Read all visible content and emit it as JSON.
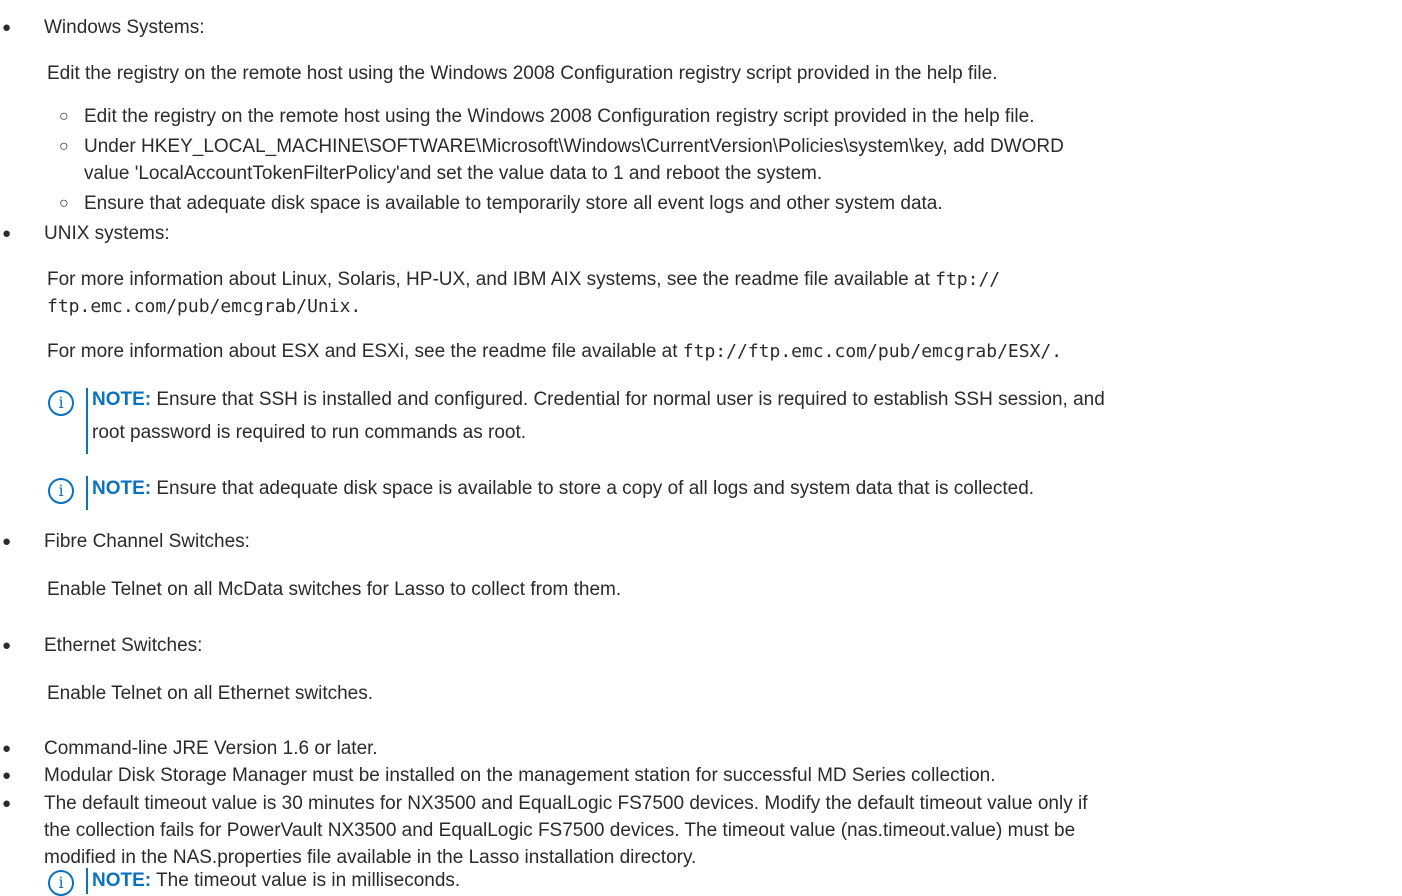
{
  "items": {
    "windows": {
      "heading": "Windows Systems:",
      "para": "Edit the registry on the remote host using the Windows 2008 Configuration registry script provided in the help file.",
      "sub": [
        "Edit the registry on the remote host using the Windows 2008 Configuration registry script provided in the help file.",
        "Under HKEY_LOCAL_MACHINE\\SOFTWARE\\Microsoft\\Windows\\CurrentVersion\\Policies\\system\\key, add DWORD",
        "value 'LocalAccountTokenFilterPolicy'and set the value data to 1 and reboot the system.",
        "Ensure that adequate disk space is available to temporarily store all event logs and other system data."
      ]
    },
    "unix": {
      "heading": "UNIX systems:",
      "para1_line1_a": "For more information about Linux, Solaris, HP-UX, and IBM AIX systems, see the readme file available at ",
      "para1_line1_b": "ftp://",
      "para1_line2": "ftp.emc.com/pub/emcgrab/Unix.",
      "para2_a": "For more information about ESX and ESXi, see the readme file available at ",
      "para2_b": "ftp://ftp.emc.com/pub/emcgrab/ESX/.",
      "note1_label": "NOTE:",
      "note1_line1": " Ensure that SSH is installed and configured. Credential for normal user is required to establish SSH session, and",
      "note1_line2": "root password is required to run commands as root.",
      "note2_label": "NOTE:",
      "note2_text": " Ensure that adequate disk space is available to store a copy of all logs and system data that is collected."
    },
    "fibre": {
      "heading": "Fibre Channel Switches:",
      "para": "Enable Telnet on all McData switches for Lasso to collect from them."
    },
    "ethernet": {
      "heading": "Ethernet Switches:",
      "para": "Enable Telnet on all Ethernet switches."
    },
    "jre": "Command-line JRE Version 1.6 or later.",
    "mdsm": "Modular Disk Storage Manager must be installed on the management station for successful MD Series collection.",
    "timeout": {
      "line1": "The default timeout value is 30 minutes for NX3500 and EqualLogic FS7500 devices. Modify the default timeout value only if",
      "line2": "the collection fails for PowerVault NX3500 and EqualLogic FS7500 devices. The timeout value (nas.timeout.value) must be",
      "line3": "modified in the NAS.properties file available in the Lasso installation directory.",
      "note_label": "NOTE:",
      "note_text": " The timeout value is in milliseconds."
    }
  },
  "glyphs": {
    "bullet": "●",
    "circle": "○",
    "info": "i"
  },
  "colors": {
    "text": "#2b2b2b",
    "accent": "#0b72c1"
  }
}
